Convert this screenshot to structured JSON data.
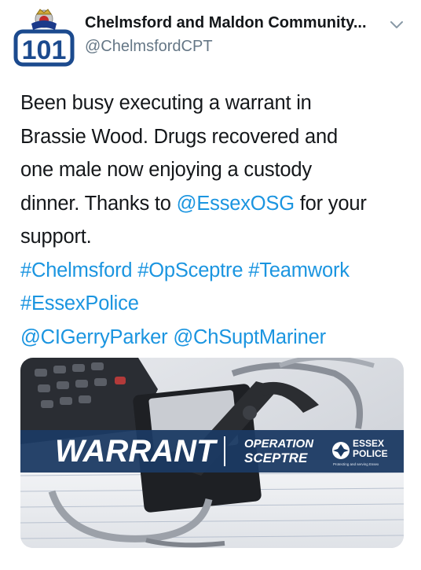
{
  "account": {
    "name": "Chelmsford and Maldon Community...",
    "handle": "@ChelmsfordCPT",
    "avatar_text": "101"
  },
  "tweet": {
    "line1": "Been busy executing a warrant in",
    "line2": "Brassie Wood. Drugs recovered and",
    "line3": "one male now enjoying a custody",
    "line4_pre": "dinner. Thanks to ",
    "mention_osg": "@EssexOSG",
    "line4_post": " for your",
    "line5": "support.",
    "hashtags_1": "#Chelmsford #OpSceptre #Teamwork",
    "hashtags_2": "#EssexPolice",
    "mentions": "@CIGerryParker @ChSuptMariner"
  },
  "media": {
    "banner_word": "WARRANT",
    "operation_line1": "OPERATION",
    "operation_line2": "SCEPTRE",
    "police_line1": "ESSEX",
    "police_line2": "POLICE",
    "police_tagline": "Protecting and serving Essex"
  },
  "colors": {
    "link": "#1b95e0",
    "banner": "#1b3a63"
  },
  "icons": {
    "menu": "chevron-down-icon"
  }
}
